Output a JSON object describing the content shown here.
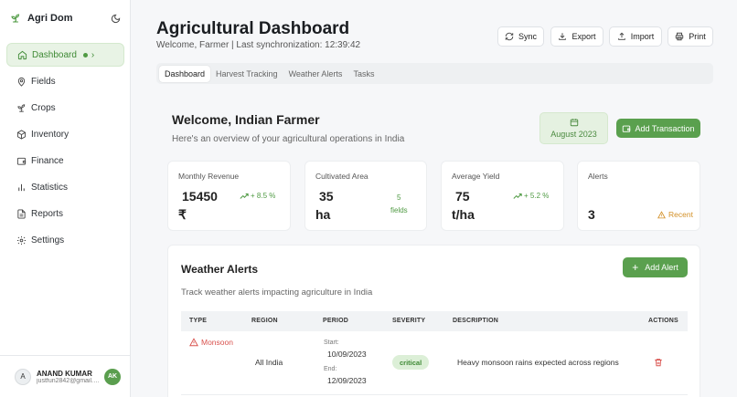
{
  "app": {
    "name": "Agri Dom"
  },
  "sidebar": {
    "items": [
      {
        "label": "Dashboard",
        "icon": "home-icon",
        "active": true
      },
      {
        "label": "Fields",
        "icon": "map-pin-icon"
      },
      {
        "label": "Crops",
        "icon": "sprout-icon"
      },
      {
        "label": "Inventory",
        "icon": "package-icon"
      },
      {
        "label": "Finance",
        "icon": "wallet-icon"
      },
      {
        "label": "Statistics",
        "icon": "bar-chart-icon"
      },
      {
        "label": "Reports",
        "icon": "file-icon"
      },
      {
        "label": "Settings",
        "icon": "gear-icon"
      }
    ]
  },
  "user": {
    "initial": "A",
    "name": "ANAND KUMAR",
    "email": "justfun2842@gmail.com",
    "badge": "AK"
  },
  "header": {
    "title": "Agricultural Dashboard",
    "subtitle": "Welcome, Farmer | Last synchronization: 12:39:42",
    "buttons": {
      "sync": "Sync",
      "export": "Export",
      "import": "Import",
      "print": "Print"
    }
  },
  "tabs": [
    "Dashboard",
    "Harvest Tracking",
    "Weather Alerts",
    "Tasks"
  ],
  "welcome": {
    "title": "Welcome, Indian Farmer",
    "subtitle": "Here's an overview of your agricultural operations in India",
    "month": "August 2023",
    "add_transaction": "Add Transaction"
  },
  "stats": {
    "revenue": {
      "label": "Monthly Revenue",
      "value": "15450",
      "unit": "₹",
      "trend": "+ 8.5 %"
    },
    "area": {
      "label": "Cultivated Area",
      "value": "35",
      "unit": "ha",
      "fields_count": "5",
      "fields_label": "fields"
    },
    "yield": {
      "label": "Average Yield",
      "value": "75",
      "unit": "t/ha",
      "trend": "+ 5.2 %"
    },
    "alerts": {
      "label": "Alerts",
      "value": "3",
      "tag": "Recent"
    }
  },
  "weather": {
    "title": "Weather Alerts",
    "description": "Track weather alerts impacting agriculture in India",
    "add_label": "Add Alert",
    "columns": {
      "type": "TYPE",
      "region": "REGION",
      "period": "PERIOD",
      "severity": "SEVERITY",
      "description": "DESCRIPTION",
      "actions": "ACTIONS"
    },
    "rows": [
      {
        "type": "Monsoon",
        "region": "All India",
        "start_label": "Start:",
        "start": "10/09/2023",
        "end_label": "End:",
        "end": "12/09/2023",
        "severity": "critical",
        "description": "Heavy monsoon rains expected across regions"
      }
    ]
  },
  "colors": {
    "accent": "#5aa04e",
    "danger": "#d9534f",
    "warning": "#d39027"
  }
}
